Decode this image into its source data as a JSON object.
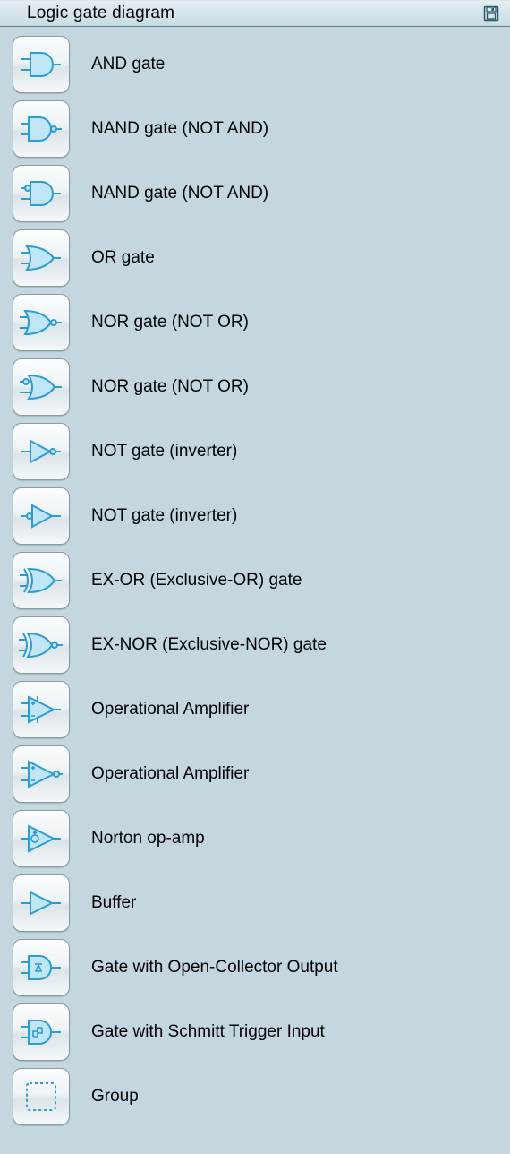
{
  "header": {
    "title": "Logic gate diagram"
  },
  "items": [
    {
      "id": "and-gate",
      "label": "AND gate"
    },
    {
      "id": "nand-gate-1",
      "label": "NAND gate (NOT AND)"
    },
    {
      "id": "nand-gate-2",
      "label": "NAND gate (NOT AND)"
    },
    {
      "id": "or-gate",
      "label": "OR gate"
    },
    {
      "id": "nor-gate-1",
      "label": "NOR gate (NOT OR)"
    },
    {
      "id": "nor-gate-2",
      "label": "NOR gate (NOT OR)"
    },
    {
      "id": "not-gate-1",
      "label": "NOT gate (inverter)"
    },
    {
      "id": "not-gate-2",
      "label": "NOT gate (inverter)"
    },
    {
      "id": "ex-or-gate",
      "label": "EX-OR (Exclusive-OR) gate"
    },
    {
      "id": "ex-nor-gate",
      "label": "EX-NOR (Exclusive-NOR) gate"
    },
    {
      "id": "op-amp-1",
      "label": "Operational Amplifier"
    },
    {
      "id": "op-amp-2",
      "label": "Operational Amplifier"
    },
    {
      "id": "norton-op-amp",
      "label": "Norton op-amp"
    },
    {
      "id": "buffer",
      "label": "Buffer"
    },
    {
      "id": "open-collector",
      "label": "Gate with Open-Collector Output"
    },
    {
      "id": "schmitt-trigger",
      "label": "Gate with Schmitt Trigger Input"
    },
    {
      "id": "group",
      "label": "Group"
    }
  ],
  "colors": {
    "symbol_stroke": "#2d9ccf",
    "symbol_fill": "#bfe6f4"
  }
}
